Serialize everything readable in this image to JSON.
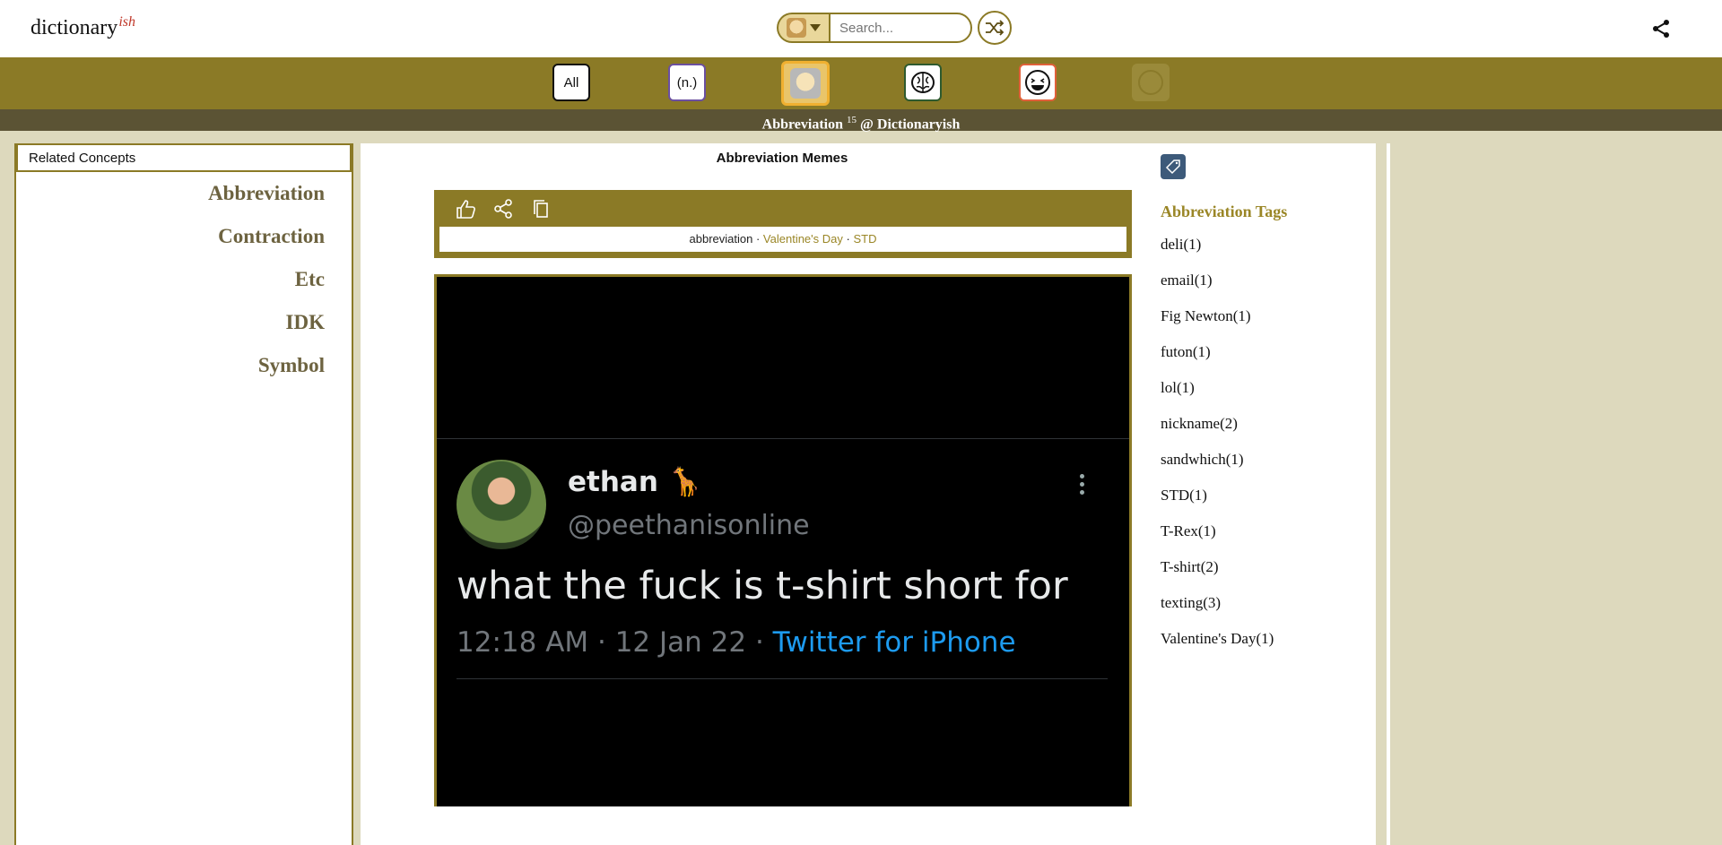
{
  "header": {
    "logo_main": "dictionary",
    "logo_suffix": "ish",
    "search_placeholder": "Search...",
    "icons": {
      "language": "doge-icon",
      "shuffle": "shuffle-icon",
      "share": "share-icon"
    }
  },
  "nav": {
    "all_label": "All",
    "noun_label": "(n.)",
    "items": [
      "doge-icon",
      "brain-icon",
      "laugh-icon",
      "smile-icon"
    ]
  },
  "subbar": {
    "word": "Abbreviation",
    "count": "15",
    "site": "@ Dictionaryish"
  },
  "left": {
    "header": "Related Concepts",
    "concepts": [
      "Abbreviation",
      "Contraction",
      "Etc",
      "IDK",
      "Symbol"
    ]
  },
  "main": {
    "title": "Abbreviation Memes",
    "card_tags": {
      "first": "abbreviation",
      "second": "Valentine's Day",
      "third": "STD",
      "sep": " · "
    },
    "meme": {
      "name": "ethan 🦒",
      "handle": "@peethanisonline",
      "text": "what the fuck is t-shirt short for",
      "meta": "12:18 AM · 12 Jan 22 · ",
      "source": "Twitter for iPhone"
    }
  },
  "tags": {
    "heading": "Abbreviation Tags",
    "items": [
      "deli(1)",
      "email(1)",
      "Fig Newton(1)",
      "futon(1)",
      "lol(1)",
      "nickname(2)",
      "sandwhich(1)",
      "STD(1)",
      "T-Rex(1)",
      "T-shirt(2)",
      "texting(3)",
      "Valentine's Day(1)"
    ]
  },
  "colors": {
    "gold": "#8b7a26",
    "band_dark": "#5b5334",
    "bg": "#ddd9bd",
    "tag_button": "#3d5a7a"
  }
}
